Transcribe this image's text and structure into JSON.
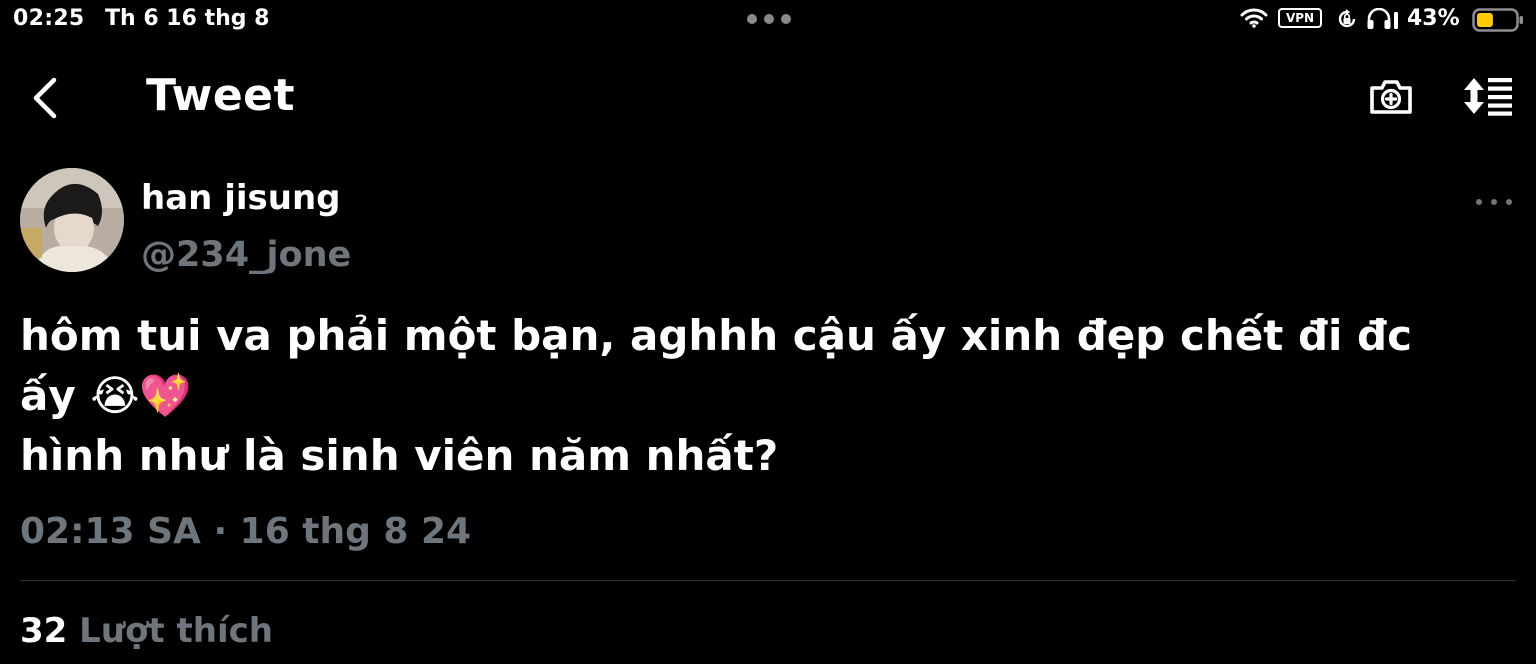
{
  "status_bar": {
    "time": "02:25",
    "date": "Th 6 16 thg 8",
    "vpn_label": "VPN",
    "battery_percent": "43%",
    "battery_level": 0.43,
    "battery_color": "#ffcc00",
    "icons": [
      "wifi-icon",
      "vpn-badge",
      "rotation-lock-icon",
      "headphones-icon",
      "battery-icon"
    ]
  },
  "nav": {
    "title": "Tweet",
    "icons": [
      "back-chevron-icon",
      "camera-plus-icon",
      "sort-lines-icon"
    ]
  },
  "tweet": {
    "author_name": "han jisung",
    "author_handle": "@234_jone",
    "text_lines": [
      "hôm tui va phải một bạn, aghhh cậu ấy xinh đẹp chết đi đc",
      "ấy 😭💖",
      "hình như là sinh viên năm nhất?"
    ],
    "timestamp": "02:13 SA · 16 thg 8 24",
    "likes_count": "32",
    "likes_label": "Lượt thích"
  },
  "colors": {
    "background": "#000000",
    "text_primary": "#ffffff",
    "text_secondary": "#6e767d",
    "divider": "#2f3336"
  }
}
